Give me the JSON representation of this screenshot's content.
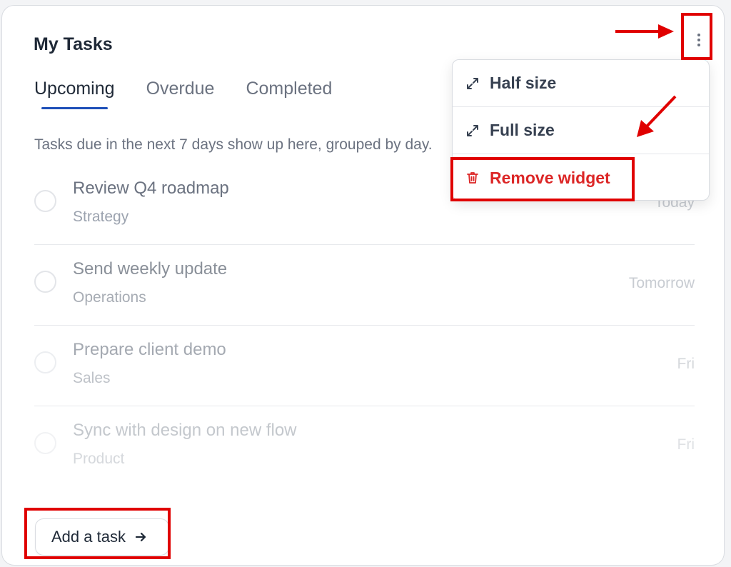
{
  "widget": {
    "title": "My Tasks",
    "tabs": [
      {
        "label": "Upcoming",
        "active": true
      },
      {
        "label": "Overdue",
        "active": false
      },
      {
        "label": "Completed",
        "active": false
      }
    ],
    "hint": "Tasks due in the next 7 days show up here, grouped by day.",
    "tasks": [
      {
        "name": "Review Q4 roadmap",
        "category": "Strategy",
        "due": "Today"
      },
      {
        "name": "Send weekly update",
        "category": "Operations",
        "due": "Tomorrow"
      },
      {
        "name": "Prepare client demo",
        "category": "Sales",
        "due": "Fri"
      },
      {
        "name": "Sync with design on new flow",
        "category": "Product",
        "due": "Fri"
      }
    ],
    "add_task_label": "Add a task"
  },
  "menu": {
    "items": [
      {
        "label": "Half size",
        "icon": "expand-icon"
      },
      {
        "label": "Full size",
        "icon": "expand-icon"
      },
      {
        "label": "Remove widget",
        "icon": "trash-icon"
      }
    ]
  },
  "colors": {
    "accent": "#1e4fb8",
    "danger": "#dc2626",
    "annotation": "#e00000"
  }
}
